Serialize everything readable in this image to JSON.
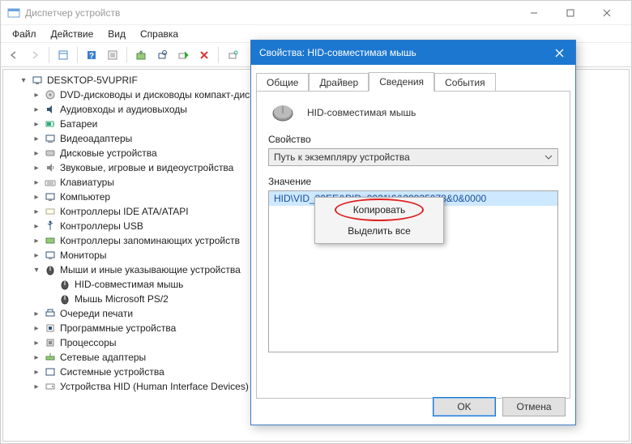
{
  "window": {
    "title": "Диспетчер устройств"
  },
  "menu": {
    "file": "Файл",
    "action": "Действие",
    "view": "Вид",
    "help": "Справка"
  },
  "tree": {
    "root": "DESKTOP-5VUPRIF",
    "items": [
      "DVD-дисководы и дисководы компакт-дисков",
      "Аудиовходы и аудиовыходы",
      "Батареи",
      "Видеоадаптеры",
      "Дисковые устройства",
      "Звуковые, игровые и видеоустройства",
      "Клавиатуры",
      "Компьютер",
      "Контроллеры IDE ATA/ATAPI",
      "Контроллеры USB",
      "Контроллеры запоминающих устройств",
      "Мониторы",
      "Мыши и иные указывающие устройства",
      "Очереди печати",
      "Программные устройства",
      "Процессоры",
      "Сетевые адаптеры",
      "Системные устройства",
      "Устройства HID (Human Interface Devices)"
    ],
    "mouse_children": [
      "HID-совместимая мышь",
      "Мышь Microsoft PS/2"
    ]
  },
  "dialog": {
    "title": "Свойства: HID-совместимая мышь",
    "tabs": {
      "general": "Общие",
      "driver": "Драйвер",
      "details": "Сведения",
      "events": "События"
    },
    "device_name": "HID-совместимая мышь",
    "property_label": "Свойство",
    "property_value": "Путь к экземпляру устройства",
    "value_label": "Значение",
    "value_text": "HID\\VID_80EE&PID_0021\\6&29935078&0&0000",
    "ok": "OK",
    "cancel": "Отмена"
  },
  "context_menu": {
    "copy": "Копировать",
    "select_all": "Выделить все"
  }
}
